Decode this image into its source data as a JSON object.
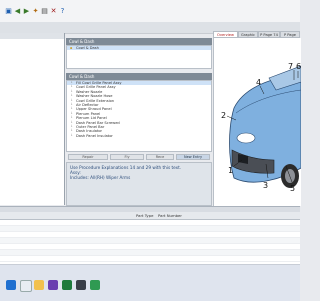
{
  "toolbar": {
    "icons": [
      "home-icon",
      "back-icon",
      "forward-icon",
      "settings-icon",
      "print-icon",
      "tools-icon",
      "help-icon"
    ]
  },
  "panels": {
    "top_header": "Cowl & Dash",
    "top_selected": "Cowl & Dash",
    "list_header": "Cowl & Dash",
    "list_items": [
      "Fill Cowl Grille Panel Assy",
      "Cowl Grille Panel Assy",
      "Washer Nozzle",
      "Washer Nozzle Hose",
      "Cowl Grille Extension",
      "Air Deflector",
      "Upper Shroud Panel",
      "Plenum Panel",
      "Plenum Lid Panel",
      "Dash Panel Bar Screwed",
      "Outer Panel Bar",
      "Dash Insulator",
      "Dash Panel Insulator"
    ],
    "buttons": [
      "Repair",
      "Fly",
      "Rece",
      "New Entry"
    ],
    "notes": [
      "Use Procedure Explanations 14 and 29 with this text.",
      "Assy:",
      "   Includes: All(RH) Wiper Arms"
    ]
  },
  "tabs": [
    "Overview",
    "Graphic",
    "P Page 74",
    "P Page"
  ],
  "callouts": [
    "1",
    "2",
    "3",
    "4",
    "5",
    "6",
    "7"
  ],
  "table": {
    "columns": [
      "Part Type",
      "Part Number"
    ]
  },
  "taskbar": {
    "icons": [
      "windows-icon",
      "search-icon",
      "file-explorer-icon",
      "app-icon",
      "excel-icon",
      "media-icon",
      "chat-icon"
    ]
  }
}
